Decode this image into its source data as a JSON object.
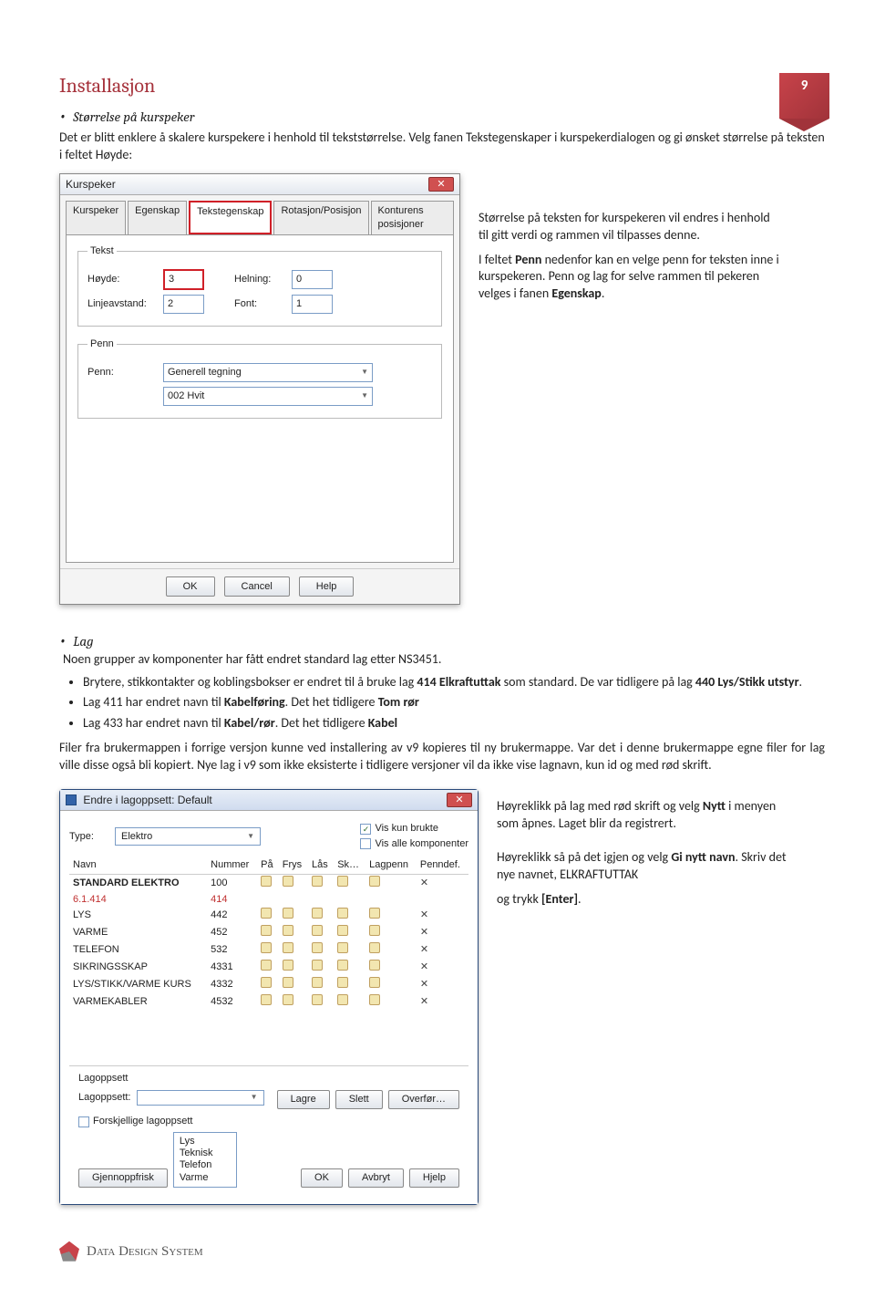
{
  "page_number": "9",
  "heading": "Installasjon",
  "sub1": {
    "title": "Størrelse på kurspeker",
    "intro": "Det er blitt enklere å skalere kurspekere i henhold til tekststørrelse. Velg fanen Tekstegenskaper i kurspekerdialogen og gi ønsket størrelse på teksten i feltet Høyde:"
  },
  "dlg1": {
    "title": "Kurspeker",
    "tabs": [
      "Kurspeker",
      "Egenskap",
      "Tekstegenskap",
      "Rotasjon/Posisjon",
      "Konturens posisjoner"
    ],
    "group_text": "Tekst",
    "hoyde_label": "Høyde:",
    "hoyde_value": "3",
    "helning_label": "Helning:",
    "helning_value": "0",
    "linjeavstand_label": "Linjeavstand:",
    "linjeavstand_value": "2",
    "font_label": "Font:",
    "font_value": "1",
    "group_penn": "Penn",
    "penn_label": "Penn:",
    "penn_value": "Generell tegning",
    "penn2_value": "002  Hvit",
    "btn_ok": "OK",
    "btn_cancel": "Cancel",
    "btn_help": "Help"
  },
  "side1": {
    "p1": "Størrelse på teksten for kurspekeren vil endres i henhold til gitt verdi og rammen vil tilpasses denne.",
    "p2_a": "I feltet ",
    "p2_penn": "Penn",
    "p2_b": " nedenfor kan en velge penn for teksten inne i kurspekeren. Penn og lag for selve rammen til pekeren velges i fanen ",
    "p2_eg": "Egenskap",
    "p2_c": "."
  },
  "sub2": {
    "title": "Lag",
    "intro": "Noen grupper av komponenter har fått endret standard lag etter NS3451.",
    "bullets": [
      {
        "a": "Brytere, stikkontakter og koblingsbokser er endret til å bruke lag ",
        "b": "414 Elkraftuttak",
        "c": " som standard. De var tidligere på lag ",
        "d": "440 Lys/Stikk utstyr",
        "e": "."
      },
      {
        "a": "Lag 411 har endret navn til ",
        "b": "Kabelføring",
        "c": ". Det het tidligere ",
        "d": "Tom rør",
        "e": ""
      },
      {
        "a": "Lag 433 har endret navn til ",
        "b": "Kabel/rør",
        "c": ". Det het tidligere ",
        "d": "Kabel",
        "e": ""
      }
    ],
    "body": "Filer fra brukermappen i forrige versjon kunne ved installering av v9 kopieres til ny brukermappe. Var det i denne brukermappe egne filer for lag ville disse også bli kopiert. Nye lag i v9 som ikke eksisterte i tidligere versjoner vil da ikke vise lagnavn, kun id og med rød skrift."
  },
  "dlg2": {
    "title": "Endre i lagoppsett: Default",
    "type_label": "Type:",
    "type_value": "Elektro",
    "chk_viskun": "Vis kun brukte",
    "chk_visalle": "Vis alle komponenter",
    "cols": [
      "Navn",
      "Nummer",
      "På",
      "Frys",
      "Lås",
      "Sk…",
      "Lagpenn",
      "Penndef."
    ],
    "rows": [
      {
        "name": "STANDARD ELEKTRO",
        "num": "100",
        "bold": true
      },
      {
        "name": "6.1.414",
        "num": "414",
        "red": true,
        "blankicons": true
      },
      {
        "name": "LYS",
        "num": "442"
      },
      {
        "name": "VARME",
        "num": "452"
      },
      {
        "name": "TELEFON",
        "num": "532"
      },
      {
        "name": "SIKRINGSSKAP",
        "num": "4331"
      },
      {
        "name": "LYS/STIKK/VARME KURS",
        "num": "4332"
      },
      {
        "name": "VARMEKABLER",
        "num": "4532"
      }
    ],
    "lagoppsett_label": "Lagoppsett",
    "lagoppsett_field": "Lagoppsett:",
    "btn_lagre": "Lagre",
    "btn_slett": "Slett",
    "btn_overfor": "Overfør…",
    "chk_forskjellige": "Forskjellige lagoppsett",
    "list": [
      "Lys",
      "Teknisk",
      "Telefon",
      "Varme"
    ],
    "btn_gjennopp": "Gjennoppfrisk",
    "btn_ok": "OK",
    "btn_avbryt": "Avbryt",
    "btn_hjelp": "Hjelp"
  },
  "side2": {
    "p1_a": "Høyreklikk på lag med rød skrift og velg ",
    "p1_b": "Nytt",
    "p1_c": " i menyen som åpnes. Laget blir da registrert.",
    "p2_a": "Høyreklikk så på det igjen og velg ",
    "p2_b": "Gi nytt navn",
    "p2_c": ". Skriv det nye navnet, ELKRAFTUTTAK",
    "p3_a": "og trykk ",
    "p3_b": "[Enter]",
    "p3_c": "."
  },
  "footer": "Data Design System"
}
